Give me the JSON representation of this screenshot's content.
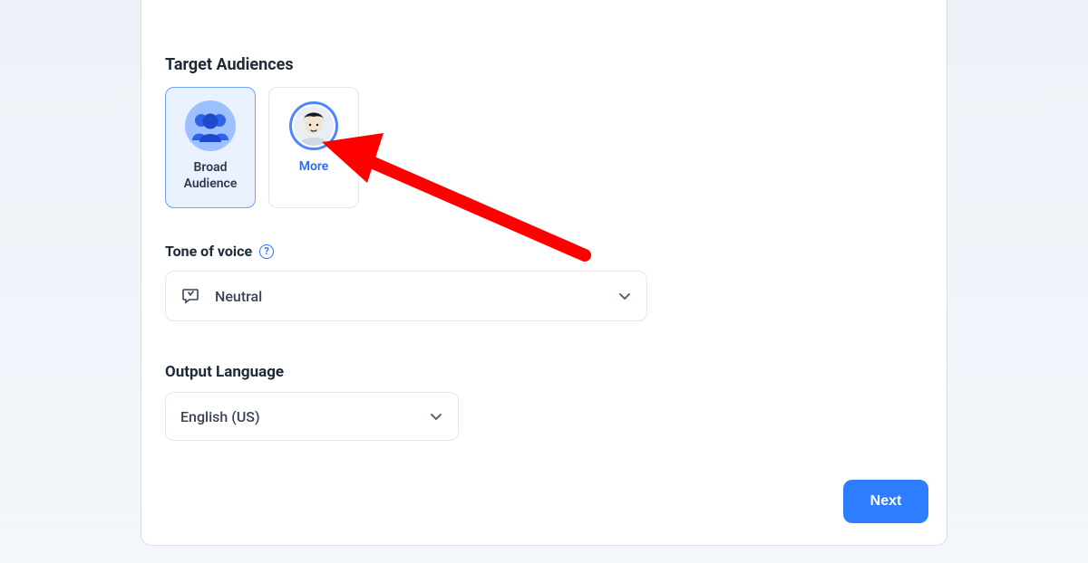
{
  "sections": {
    "target_audiences": {
      "title": "Target Audiences",
      "cards": [
        {
          "label": "Broad Audience",
          "key": "broad-audience",
          "selected": true
        },
        {
          "label": "More",
          "key": "more",
          "selected": false
        }
      ]
    },
    "tone": {
      "label": "Tone of voice",
      "value": "Neutral"
    },
    "language": {
      "label": "Output Language",
      "value": "English (US)"
    }
  },
  "buttons": {
    "next": "Next"
  },
  "annotation": {
    "color": "#ff0000",
    "target": "more-audience-card"
  }
}
